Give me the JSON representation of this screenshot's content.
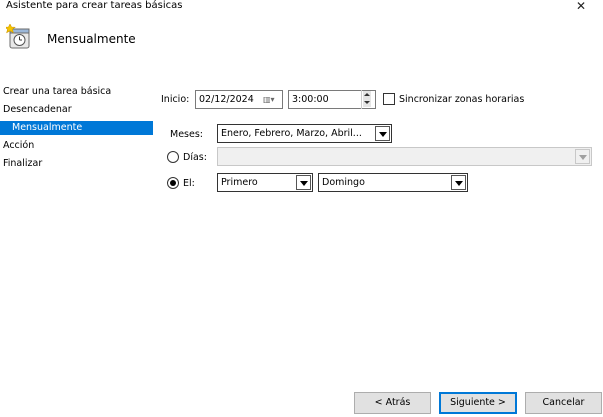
{
  "window": {
    "title": "Asistente para crear tareas básicas",
    "close_glyph": "✕"
  },
  "header": {
    "title": "Mensualmente",
    "icon": "scheduled-task-clock-icon"
  },
  "sidebar": {
    "items": [
      {
        "label": "Crear una tarea básica"
      },
      {
        "label": "Desencadenar"
      },
      {
        "label": "Mensualmente",
        "selected": true
      },
      {
        "label": "Acción"
      },
      {
        "label": "Finalizar"
      }
    ]
  },
  "form": {
    "start_label": "Inicio:",
    "start_date": "02/12/2024",
    "start_time": "3:00:00",
    "sync_timezones_label": "Sincronizar zonas horarias",
    "sync_timezones_checked": false,
    "months_label": "Meses:",
    "months_value": "Enero, Febrero, Marzo, Abril...",
    "days_label": "Días:",
    "days_value": "",
    "days_selected": false,
    "on_label": "El:",
    "on_selected": true,
    "week_value": "Primero",
    "weekday_value": "Domingo"
  },
  "buttons": {
    "back": "< Atrás",
    "next": "Siguiente >",
    "cancel": "Cancelar"
  },
  "colors": {
    "selection": "#0078d7"
  }
}
